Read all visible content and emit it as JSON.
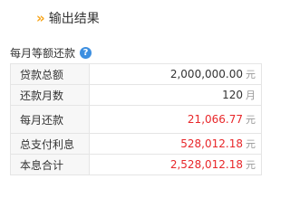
{
  "header": {
    "chevron": "»",
    "title": "输出结果"
  },
  "section": {
    "title": "每月等额还款",
    "help_glyph": "?"
  },
  "colors": {
    "accent": "#f7a51c",
    "help": "#3d8fe0",
    "highlight": "#e8272a"
  },
  "rows": [
    {
      "label": "贷款总额",
      "value": "2,000,000.00",
      "unit": "元"
    },
    {
      "label": "还款月数",
      "value": "120",
      "unit": "月"
    },
    {
      "label": "每月还款",
      "value": "21,066.77",
      "unit": "元"
    },
    {
      "label": "总支付利息",
      "value": "528,012.18",
      "unit": "元"
    },
    {
      "label": "本息合计",
      "value": "2,528,012.18",
      "unit": "元"
    }
  ]
}
